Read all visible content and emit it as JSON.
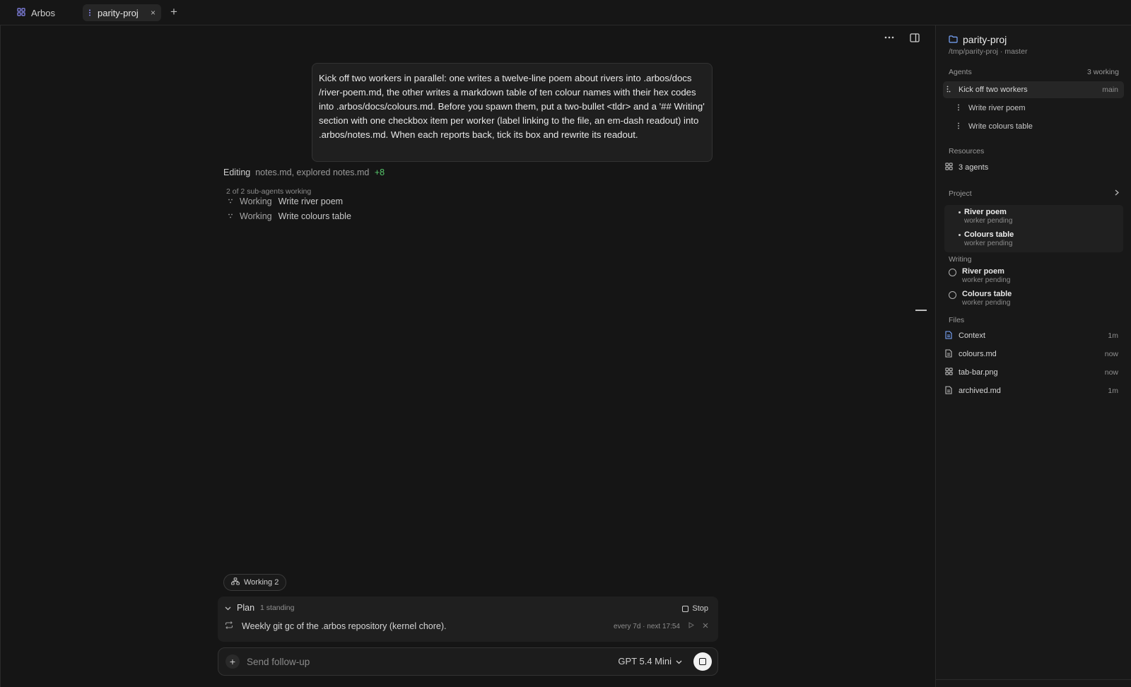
{
  "tabs": {
    "home_label": "Arbos",
    "active_label": "parity-proj",
    "close_glyph": "×",
    "add_glyph": "+"
  },
  "main": {
    "user_message": "Kick off two workers in parallel: one writes a twelve-line poem about rivers into .arbos/docs /river-poem.md, the other writes a markdown table of ten colour names with their hex codes into .arbos/docs/colours.md. Before you spawn them, put a two-bullet <tldr> and a '## Writing' section with one checkbox item per worker (label linking to the file, an em-dash readout) into .arbos/notes.md. When each reports back, tick its box and rewrite its readout.",
    "editing": {
      "verb": "Editing",
      "detail": "notes.md, explored notes.md",
      "extra": "+8"
    },
    "subagents_heading": "2 of 2 sub-agents working",
    "subagents": [
      {
        "status": "Working",
        "label": "Write river poem"
      },
      {
        "status": "Working",
        "label": "Write colours table"
      }
    ],
    "working_pill": "Working 2",
    "plan": {
      "label": "Plan",
      "count": "1 standing",
      "stop_label": "Stop",
      "item_text": "Weekly git gc of the .arbos repository (kernel chore).",
      "item_schedule": "every 7d · next 17:54"
    },
    "composer": {
      "placeholder": "Send follow-up",
      "model": "GPT 5.4 Mini"
    }
  },
  "sidebar": {
    "project_name": "parity-proj",
    "project_path": "/tmp/parity-proj · master",
    "agents_label": "Agents",
    "agents_status": "3 working",
    "agents": [
      {
        "label": "Kick off two workers",
        "tag": "main"
      },
      {
        "label": "Write river poem",
        "tag": ""
      },
      {
        "label": "Write colours table",
        "tag": ""
      }
    ],
    "resources_label": "Resources",
    "resources": [
      {
        "label": "3 agents"
      }
    ],
    "project_label": "Project",
    "project_items": [
      {
        "title": "River poem",
        "status": "worker pending"
      },
      {
        "title": "Colours table",
        "status": "worker pending"
      }
    ],
    "writing_label": "Writing",
    "writing_items": [
      {
        "title": "River poem",
        "status": "worker pending"
      },
      {
        "title": "Colours table",
        "status": "worker pending"
      }
    ],
    "files_label": "Files",
    "files": [
      {
        "name": "Context",
        "time": "1m",
        "icon": "doc-icon"
      },
      {
        "name": "colours.md",
        "time": "now",
        "icon": "doc-icon"
      },
      {
        "name": "tab-bar.png",
        "time": "now",
        "icon": "grid-icon"
      },
      {
        "name": "archived.md",
        "time": "1m",
        "icon": "doc-icon"
      }
    ]
  },
  "colors": {
    "background": "#151515",
    "sidebar": "#181818",
    "accent_green": "#55c76a",
    "folder_blue": "#7aa7ff"
  }
}
